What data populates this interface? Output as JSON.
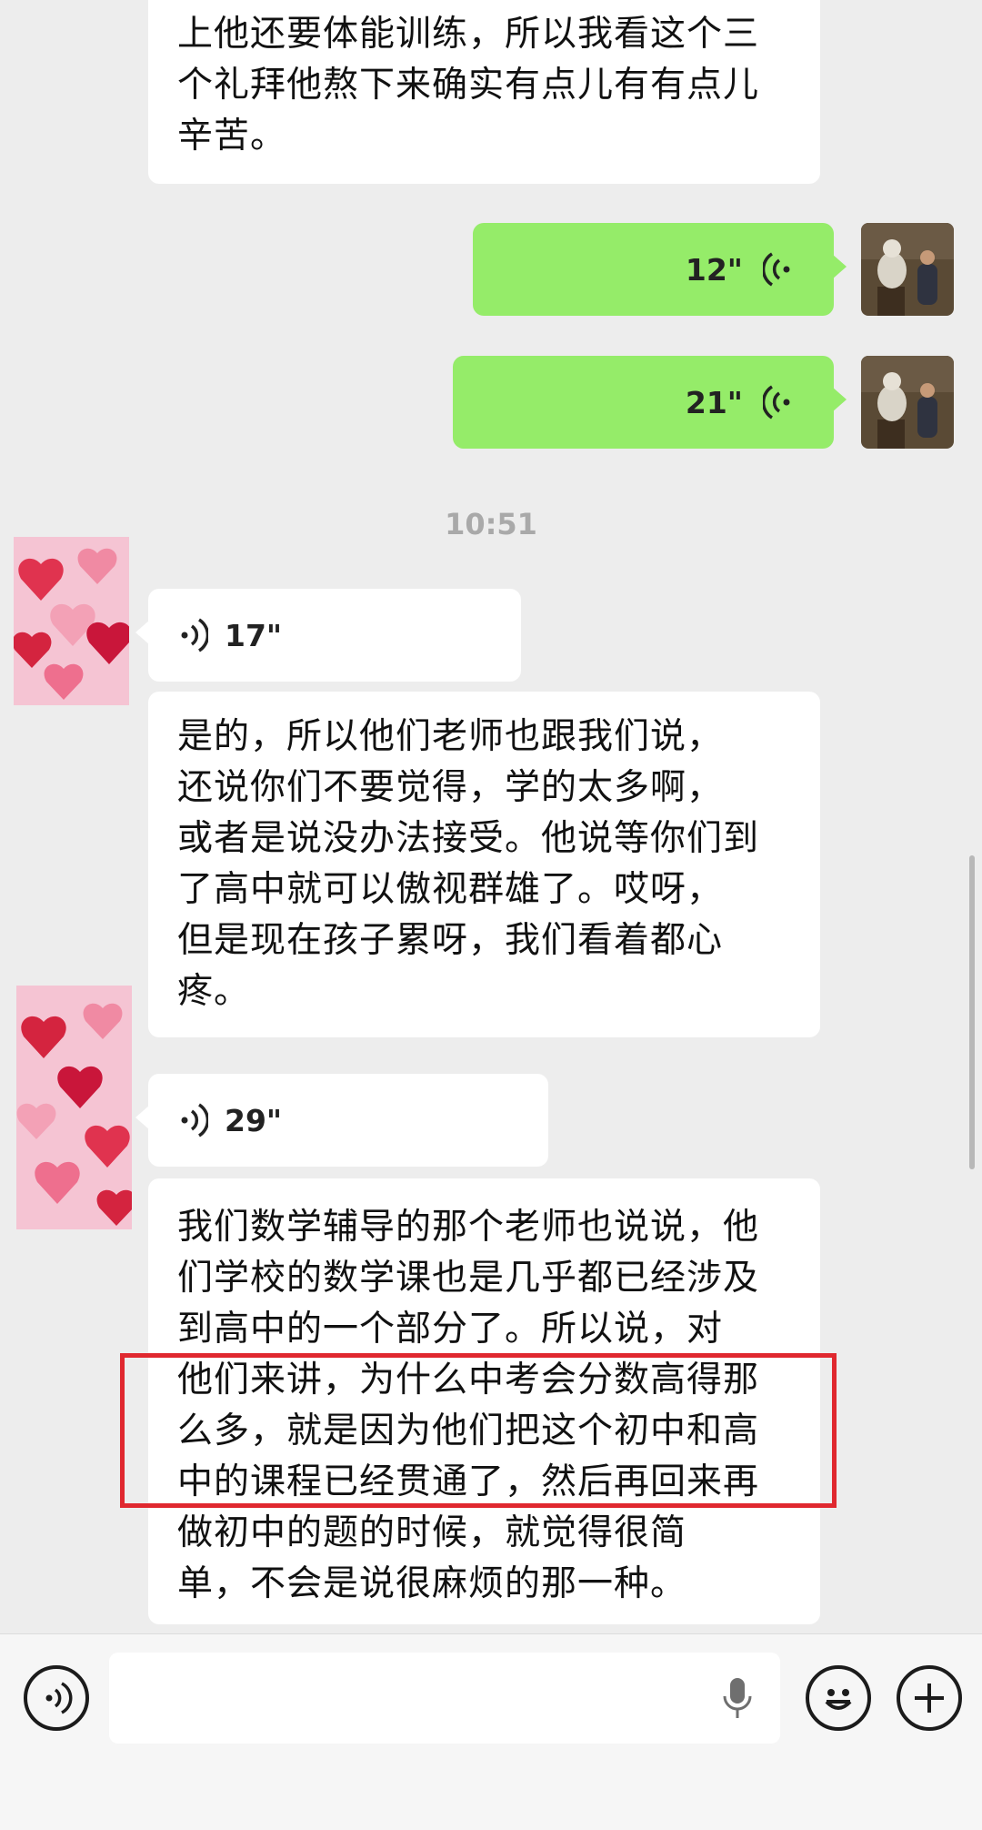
{
  "messages": {
    "m1_text": "上他还要体能训练，所以我看这个三\n个礼拜他熬下来确实有点儿有有点儿\n辛苦。",
    "m2_duration": "12\"",
    "m3_duration": "21\"",
    "timestamp": "10:51",
    "m4_duration": "17\"",
    "m5_text": "是的，所以他们老师也跟我们说，\n还说你们不要觉得，学的太多啊，\n或者是说没办法接受。他说等你们到\n了高中就可以傲视群雄了。哎呀，\n但是现在孩子累呀，我们看着都心\n疼。",
    "m6_duration": "29\"",
    "m7_text": "我们数学辅导的那个老师也说说，他\n们学校的数学课也是几乎都已经涉及\n到高中的一个部分了。所以说，对\n他们来讲，为什么中考会分数高得那\n么多，就是因为他们把这个初中和高\n中的课程已经贯通了，然后再回来再\n做初中的题的时候，就觉得很简\n单，不会是说很麻烦的那一种。"
  },
  "colors": {
    "chat_background": "#ededed",
    "sent_bubble": "#95ec69",
    "received_bubble": "#ffffff",
    "highlight_box": "#e0282f",
    "timestamp_text": "#a9a9a9"
  },
  "input_bar": {
    "voice_button_icon": "voice-mode-icon",
    "mic_icon": "microphone-icon",
    "emoji_icon": "smiley-icon",
    "plus_icon": "plus-icon"
  }
}
